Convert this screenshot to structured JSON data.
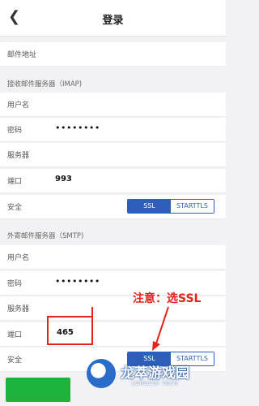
{
  "header": {
    "back_icon": "chevron-left-icon",
    "title": "登录"
  },
  "email": {
    "label": "邮件地址"
  },
  "imap": {
    "section_title": "接收邮件服务器（IMAP)",
    "username_label": "用户名",
    "password_label": "密码",
    "password_value": "••••••••",
    "server_label": "服务器",
    "port_label": "端口",
    "port_value": "993",
    "security_label": "安全",
    "security_options": [
      "SSL",
      "STARTTLS"
    ],
    "security_selected": "SSL"
  },
  "smtp": {
    "section_title": "外寄邮件服务器（SMTP)",
    "username_label": "用户名",
    "password_label": "密码",
    "password_value": "••••••••",
    "server_label": "服务器",
    "port_label": "端口",
    "port_value": "465",
    "security_label": "安全",
    "security_options": [
      "SSL",
      "STARTTLS"
    ],
    "security_selected": "SSL"
  },
  "annotation": {
    "text": "注意：选SSL",
    "color": "#e2231a"
  },
  "watermark": {
    "title": "龙萃游戏园",
    "subtitle": "LONGCUI TECH"
  },
  "colors": {
    "accent": "#2d5fb8",
    "button": "#1db33a",
    "annotation": "#e2231a"
  }
}
